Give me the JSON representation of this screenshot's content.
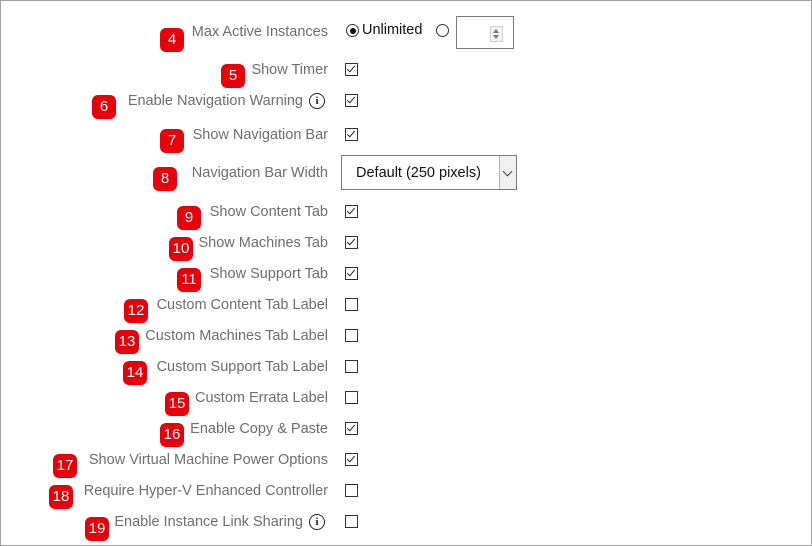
{
  "settings": {
    "max_active_instances": {
      "badge": "4",
      "label": "Max Active Instances",
      "option_unlimited": "Unlimited",
      "selected": "unlimited",
      "number_value": ""
    },
    "show_timer": {
      "badge": "5",
      "label": "Show Timer",
      "checked": true
    },
    "enable_navigation_warning": {
      "badge": "6",
      "label": "Enable Navigation Warning",
      "checked": true,
      "icon": "info-icon"
    },
    "show_navigation_bar": {
      "badge": "7",
      "label": "Show Navigation Bar",
      "checked": true
    },
    "navigation_bar_width": {
      "badge": "8",
      "label": "Navigation Bar Width",
      "selected": "Default (250 pixels)"
    },
    "show_content_tab": {
      "badge": "9",
      "label": "Show Content Tab",
      "checked": true
    },
    "show_machines_tab": {
      "badge": "10",
      "label": "Show Machines Tab",
      "checked": true
    },
    "show_support_tab": {
      "badge": "11",
      "label": "Show Support Tab",
      "checked": true
    },
    "custom_content_tab_label": {
      "badge": "12",
      "label": "Custom Content Tab Label",
      "checked": false
    },
    "custom_machines_tab_label": {
      "badge": "13",
      "label": "Custom Machines Tab Label",
      "checked": false
    },
    "custom_support_tab_label": {
      "badge": "14",
      "label": "Custom Support Tab Label",
      "checked": false
    },
    "custom_errata_label": {
      "badge": "15",
      "label": "Custom Errata Label",
      "checked": false
    },
    "enable_copy_paste": {
      "badge": "16",
      "label": "Enable Copy & Paste",
      "checked": true
    },
    "show_vm_power_options": {
      "badge": "17",
      "label": "Show Virtual Machine Power Options",
      "checked": true
    },
    "require_hyperv_enhanced_controller": {
      "badge": "18",
      "label": "Require Hyper-V Enhanced Controller",
      "checked": false
    },
    "enable_instance_link_sharing": {
      "badge": "19",
      "label": "Enable Instance Link Sharing",
      "checked": false,
      "icon": "info-icon"
    }
  },
  "colors": {
    "badge_bg": "#e8000b",
    "label_text": "#6e6e6e"
  }
}
